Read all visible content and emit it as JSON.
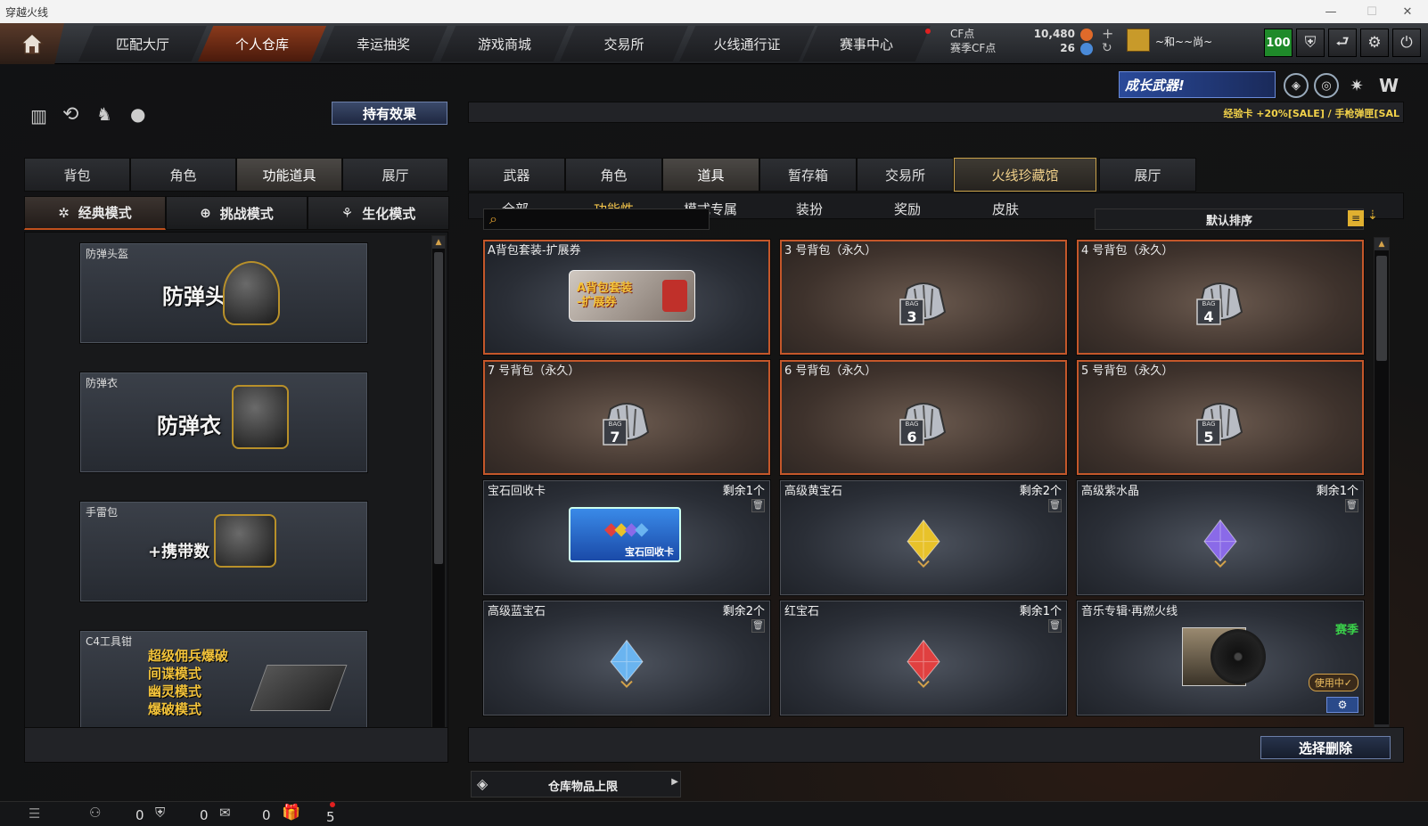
{
  "window": {
    "title": "穿越火线"
  },
  "nav": {
    "tabs": [
      "匹配大厅",
      "个人仓库",
      "幸运抽奖",
      "游戏商城",
      "交易所",
      "火线通行证",
      "赛事中心"
    ],
    "active_tab": "个人仓库",
    "cf_label": "CF点",
    "cf_value": "10,480",
    "season_label": "赛季CF点",
    "season_value": "26",
    "user_name": "~和~~尚~",
    "level": "100"
  },
  "banner": {
    "text": "成长武器!",
    "ticker": "经验卡 +20%[SALE] / 手枪弹匣[SAL"
  },
  "left": {
    "effects_button": "持有效果",
    "tabs": [
      "背包",
      "角色",
      "功能道具",
      "展厅"
    ],
    "active_tab": "功能道具",
    "modes": [
      "经典模式",
      "挑战模式",
      "生化模式"
    ],
    "active_mode": "经典模式",
    "effects": [
      {
        "caption": "防弹头盔",
        "label": "防弹头盔"
      },
      {
        "caption": "防弹衣",
        "label": "防弹衣"
      },
      {
        "caption": "手雷包",
        "label": "+携带数"
      },
      {
        "caption": "C4工具钳",
        "lines": [
          "超级佣兵爆破",
          "间谍模式",
          "幽灵模式",
          "爆破模式"
        ]
      }
    ]
  },
  "right": {
    "tabs": [
      "武器",
      "角色",
      "道具",
      "暂存箱",
      "交易所",
      "火线珍藏馆",
      "展厅"
    ],
    "active_tab": "道具",
    "highlight_tab": "火线珍藏馆",
    "subtabs": [
      "全部",
      "功能性",
      "模式专属",
      "装扮",
      "奖励",
      "皮肤"
    ],
    "active_subtab": "功能性",
    "search": {
      "placeholder": ""
    },
    "sort_label": "默认排序",
    "items": [
      {
        "name": "A背包套装-扩展券",
        "count": "",
        "type": "ticket",
        "art": "A背包套装\n-扩展券"
      },
      {
        "name": "3 号背包（永久）",
        "count": "",
        "type": "bag",
        "num": "3"
      },
      {
        "name": "4 号背包（永久）",
        "count": "",
        "type": "bag",
        "num": "4"
      },
      {
        "name": "7 号背包（永久）",
        "count": "",
        "type": "bag",
        "num": "7"
      },
      {
        "name": "6 号背包（永久）",
        "count": "",
        "type": "bag",
        "num": "6"
      },
      {
        "name": "5 号背包（永久）",
        "count": "",
        "type": "bag",
        "num": "5"
      },
      {
        "name": "宝石回收卡",
        "count": "剩余1个",
        "type": "card",
        "art": "宝石回收卡"
      },
      {
        "name": "高级黄宝石",
        "count": "剩余2个",
        "type": "gem",
        "color": "#e8c22a"
      },
      {
        "name": "高级紫水晶",
        "count": "剩余1个",
        "type": "gem",
        "color": "#8a6ae8"
      },
      {
        "name": "高级蓝宝石",
        "count": "剩余2个",
        "type": "gem",
        "color": "#6ab4f0"
      },
      {
        "name": "红宝石",
        "count": "剩余1个",
        "type": "gem",
        "color": "#e04040"
      },
      {
        "name": "音乐专辑·再燃火线",
        "count": "",
        "type": "music",
        "badge": "赛季",
        "status": "使用中✓"
      }
    ],
    "delete_button": "选择删除",
    "storage_label": "仓库物品上限"
  },
  "status": {
    "counts": [
      "0",
      "0",
      "0",
      "5"
    ]
  }
}
